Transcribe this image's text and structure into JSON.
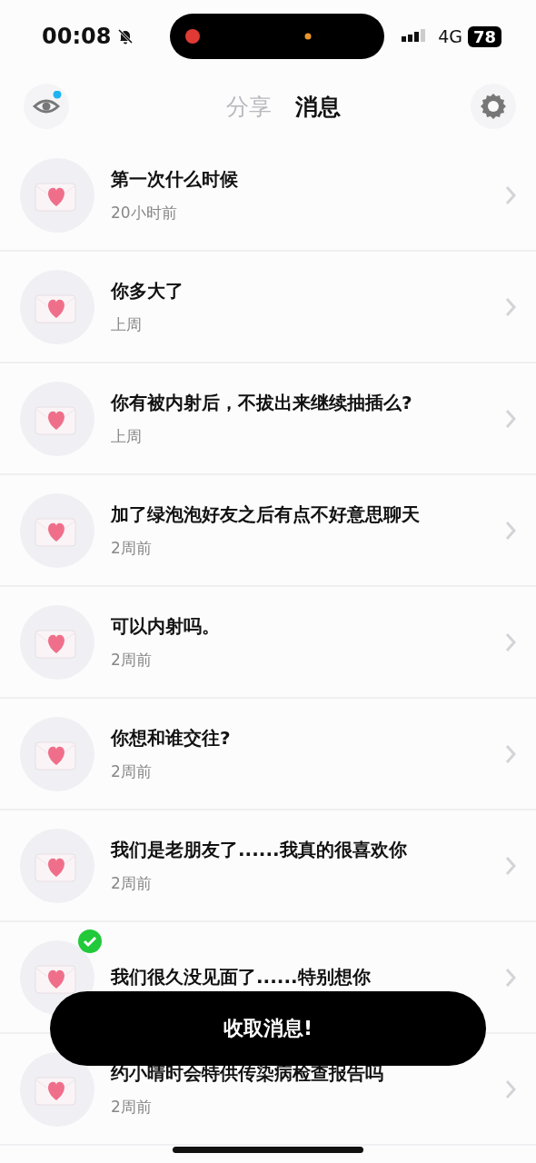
{
  "status_bar": {
    "time": "00:08",
    "network": "4G",
    "battery": "78"
  },
  "tabs": [
    {
      "label": "分享",
      "selected": false
    },
    {
      "label": "消息",
      "selected": true
    }
  ],
  "messages": [
    {
      "title": "第一次什么时候",
      "time": "20小时前",
      "checked": false
    },
    {
      "title": "你多大了",
      "time": "上周",
      "checked": false
    },
    {
      "title": "你有被内射后，不拔出来继续抽插么?",
      "time": "上周",
      "checked": false
    },
    {
      "title": "加了绿泡泡好友之后有点不好意思聊天",
      "time": "2周前",
      "checked": false
    },
    {
      "title": "可以内射吗。",
      "time": "2周前",
      "checked": false
    },
    {
      "title": "你想和谁交往?",
      "time": "2周前",
      "checked": false
    },
    {
      "title": "我们是老朋友了......我真的很喜欢你",
      "time": "2周前",
      "checked": false
    },
    {
      "title": "我们很久没见面了......特别想你",
      "checked": true
    },
    {
      "title": "约小晴时会特供传染病检查报告吗",
      "time": "2周前",
      "checked": false
    }
  ],
  "action_button": "收取消息!"
}
